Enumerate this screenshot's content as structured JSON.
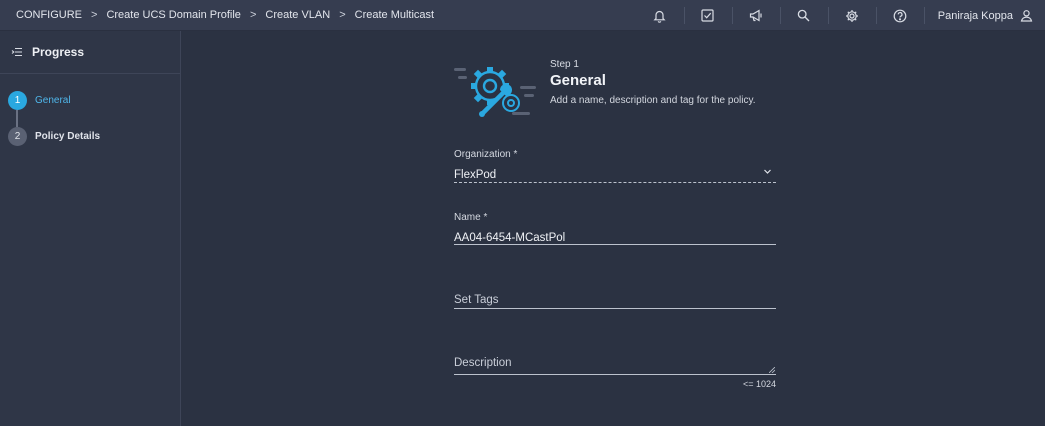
{
  "breadcrumb": [
    "CONFIGURE",
    "Create UCS Domain Profile",
    "Create VLAN",
    "Create Multicast"
  ],
  "header": {
    "icons": [
      "bell-icon",
      "task-check-icon",
      "megaphone-icon",
      "search-icon",
      "gear-icon",
      "help-icon"
    ],
    "user_name": "Paniraja Koppa"
  },
  "sidebar": {
    "title": "Progress",
    "steps": [
      {
        "number": "1",
        "label": "General",
        "state": "active"
      },
      {
        "number": "2",
        "label": "Policy Details",
        "state": "todo"
      }
    ]
  },
  "main": {
    "step_caption": "Step 1",
    "title": "General",
    "subtitle": "Add a name, description and tag for the policy.",
    "organization": {
      "label": "Organization *",
      "value": "FlexPod"
    },
    "name": {
      "label": "Name *",
      "value": "AA04-6454-MCastPol"
    },
    "tags": {
      "placeholder": "Set Tags"
    },
    "description": {
      "placeholder": "Description",
      "limit": "<= 1024"
    }
  },
  "colors": {
    "accent": "#2aa8e0",
    "background": "#2b3242",
    "topbar": "#363d50",
    "sidebar": "#2f3647"
  }
}
